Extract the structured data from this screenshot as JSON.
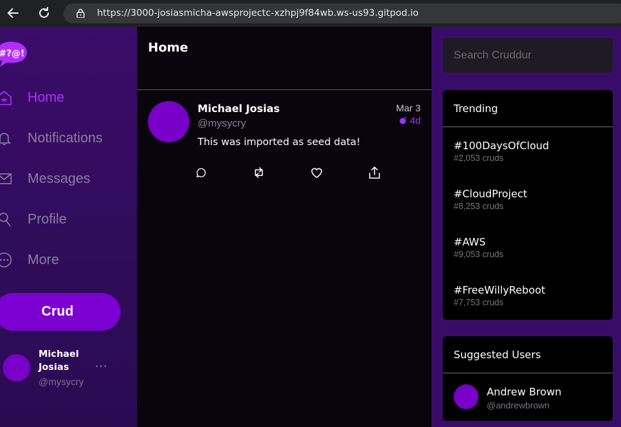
{
  "browser": {
    "url": "https://3000-josiasmicha-awsprojectc-xzhpj9f84wb.ws-us93.gitpod.io"
  },
  "sidebar": {
    "logo_text": "#?@!",
    "items": [
      {
        "label": "Home",
        "icon": "home-icon",
        "active": true
      },
      {
        "label": "Notifications",
        "icon": "bell-icon",
        "active": false
      },
      {
        "label": "Messages",
        "icon": "mail-icon",
        "active": false
      },
      {
        "label": "Profile",
        "icon": "user-icon",
        "active": false
      },
      {
        "label": "More",
        "icon": "more-circle-icon",
        "active": false
      }
    ],
    "crud_button": "Crud",
    "profile": {
      "name": "Michael Josias",
      "handle": "@mysycry",
      "more": "···"
    }
  },
  "main": {
    "title": "Home",
    "posts": [
      {
        "name": "Michael Josias",
        "handle": "@mysycry",
        "date": "Mar 3",
        "expires": "4d",
        "text": "This was imported as seed data!",
        "actions": [
          "reply-icon",
          "repost-icon",
          "like-icon",
          "share-icon"
        ]
      }
    ]
  },
  "right": {
    "search_placeholder": "Search Cruddur",
    "trending": {
      "title": "Trending",
      "items": [
        {
          "name": "#100DaysOfCloud",
          "count": "#2,053 cruds"
        },
        {
          "name": "#CloudProject",
          "count": "#8,253 cruds"
        },
        {
          "name": "#AWS",
          "count": "#9,053 cruds"
        },
        {
          "name": "#FreeWillyReboot",
          "count": "#7,753 cruds"
        }
      ]
    },
    "suggested": {
      "title": "Suggested Users",
      "users": [
        {
          "name": "Andrew Brown",
          "handle": "@andrewbrown"
        }
      ]
    }
  },
  "colors": {
    "accent": "#7d00d3",
    "active_nav": "#b22dff",
    "sidebar_bg": "#3b0c6a",
    "main_bg": "#0a040d"
  }
}
